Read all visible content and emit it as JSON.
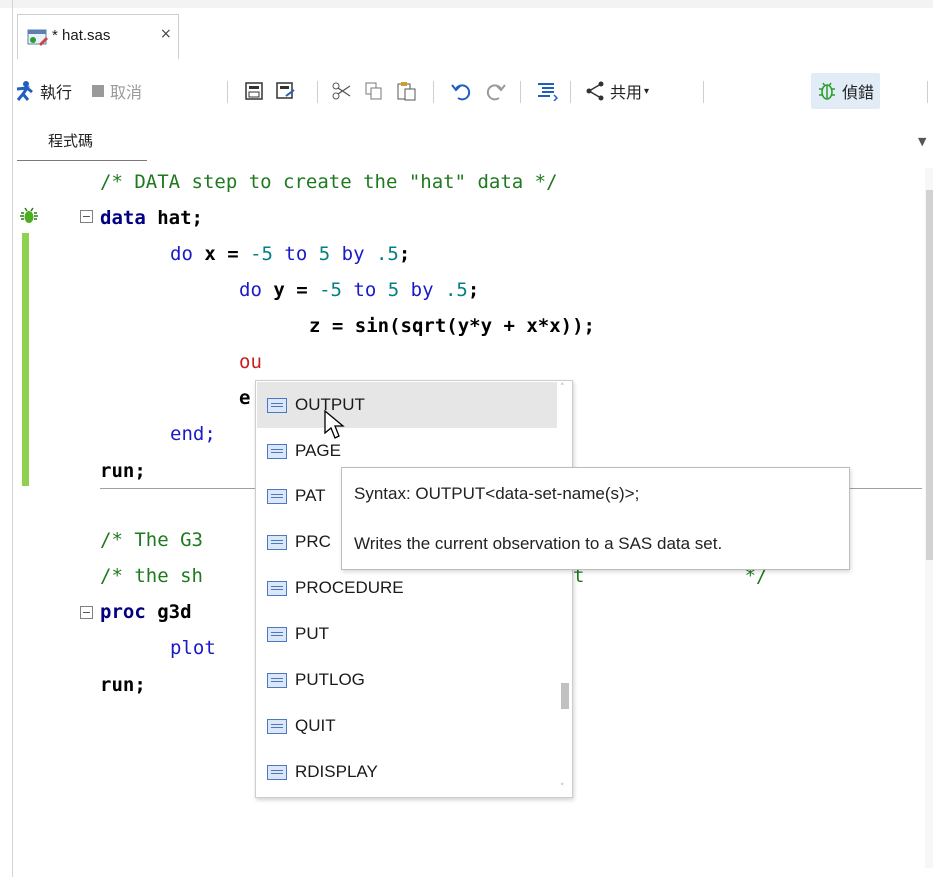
{
  "tab": {
    "label": "* hat.sas",
    "close": "×"
  },
  "toolbar": {
    "run": "執行",
    "cancel": "取消",
    "share": "共用",
    "debug": "偵錯"
  },
  "editor": {
    "subtab": "程式碼",
    "lines": {
      "l1_comment": "/* DATA step to create the \"hat\" data */",
      "l2_kw": "data",
      "l2_rest": " hat;",
      "l3_a": "do",
      "l3_b": " x = ",
      "l3_c": "-5",
      "l3_d": " to ",
      "l3_e": "5",
      "l3_f": " by ",
      "l3_g": ".5",
      "l3_h": ";",
      "l4_a": "do",
      "l4_b": " y = ",
      "l4_c": "-5",
      "l4_d": " to ",
      "l4_e": "5",
      "l4_f": " by ",
      "l4_g": ".5",
      "l4_h": ";",
      "l5": "z = sin(sqrt(y*y + x*x));",
      "l6": "ou",
      "l7": "e",
      "l8": "end;",
      "l9": "run;",
      "l10_comment": "/* The G3",
      "l11_comment": "/* the sh",
      "l11_tail": "t              */",
      "l12_kw": "proc",
      "l12_rest": " g3d",
      "l13": "plot",
      "l14": "run;"
    }
  },
  "autocomplete": {
    "items": [
      "OUTPUT",
      "PAGE",
      "PAT",
      "PRC",
      "PROCEDURE",
      "PUT",
      "PUTLOG",
      "QUIT",
      "RDISPLAY"
    ],
    "selected": "OUTPUT"
  },
  "tooltip": {
    "syntax": "Syntax: OUTPUT<data-set-name(s)>;",
    "description": "Writes the current observation to a SAS data set."
  },
  "colors": {
    "accent_gutter": "#8fd14f",
    "keyword": "#1a1ac8",
    "comment": "#1f7a1f",
    "number": "#008080",
    "error_text": "#c81e1e"
  }
}
